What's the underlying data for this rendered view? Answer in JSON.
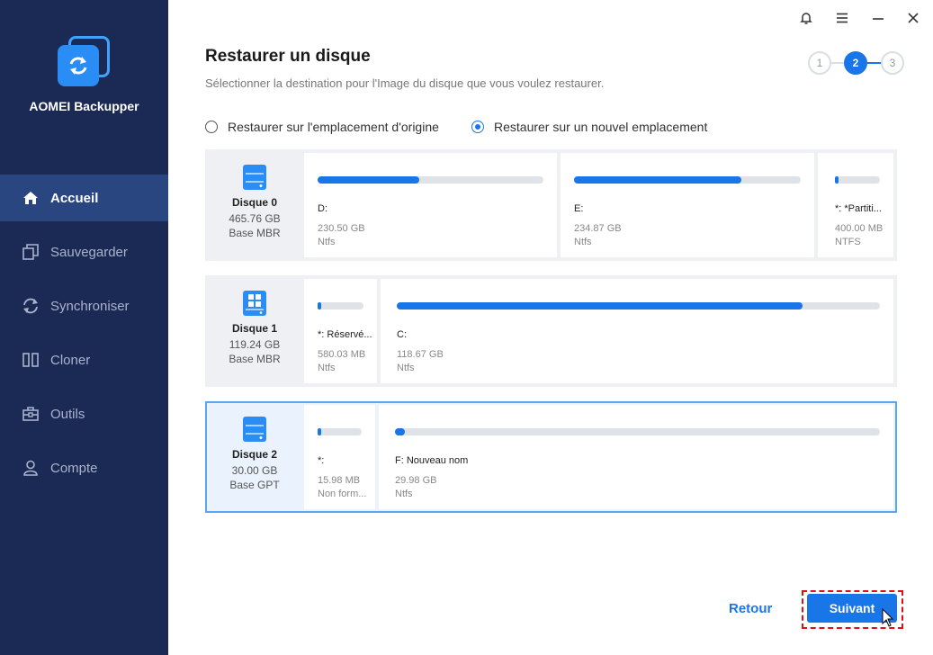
{
  "app": {
    "name": "AOMEI Backupper"
  },
  "sidebar": {
    "items": [
      {
        "label": "Accueil",
        "icon": "home-icon",
        "active": true
      },
      {
        "label": "Sauvegarder",
        "icon": "backup-icon"
      },
      {
        "label": "Synchroniser",
        "icon": "sync-icon"
      },
      {
        "label": "Cloner",
        "icon": "clone-icon"
      },
      {
        "label": "Outils",
        "icon": "toolbox-icon"
      },
      {
        "label": "Compte",
        "icon": "user-icon"
      }
    ]
  },
  "header": {
    "title": "Restaurer un disque",
    "subtitle": "Sélectionner la destination pour l'Image du disque que vous voulez restaurer."
  },
  "steps": [
    {
      "label": "1",
      "active": false
    },
    {
      "label": "2",
      "active": true
    },
    {
      "label": "3",
      "active": false
    }
  ],
  "options": {
    "original": "Restaurer sur l'emplacement d'origine",
    "new": "Restaurer sur un nouvel emplacement",
    "selected": "new"
  },
  "disks": [
    {
      "name": "Disque 0",
      "size": "465.76 GB",
      "type": "Base MBR",
      "icon": "disk-icon",
      "partitions": [
        {
          "name": "D:",
          "size": "230.50 GB",
          "fs": "Ntfs",
          "used": 0.45
        },
        {
          "name": "E:",
          "size": "234.87 GB",
          "fs": "Ntfs",
          "used": 0.74
        },
        {
          "name": "*: *Partiti...",
          "size": "400.00 MB",
          "fs": "NTFS",
          "used": 0.05
        }
      ]
    },
    {
      "name": "Disque 1",
      "size": "119.24 GB",
      "type": "Base MBR",
      "icon": "windows-disk-icon",
      "partitions": [
        {
          "name": "*: Réservé...",
          "size": "580.03 MB",
          "fs": "Ntfs",
          "used": 0.06
        },
        {
          "name": "C:",
          "size": "118.67 GB",
          "fs": "Ntfs",
          "used": 0.84
        }
      ]
    },
    {
      "name": "Disque 2",
      "size": "30.00 GB",
      "type": "Base GPT",
      "icon": "disk-icon",
      "selected": true,
      "partitions": [
        {
          "name": "*:",
          "size": "15.98 MB",
          "fs": "Non form...",
          "used": 0.05
        },
        {
          "name": "F: Nouveau nom",
          "size": "29.98 GB",
          "fs": "Ntfs",
          "used": 0.02
        }
      ]
    }
  ],
  "footer": {
    "back": "Retour",
    "next": "Suivant"
  },
  "colors": {
    "sidebar": "#1b2a55",
    "accent": "#1976e8",
    "highlight": "#dd1111"
  }
}
